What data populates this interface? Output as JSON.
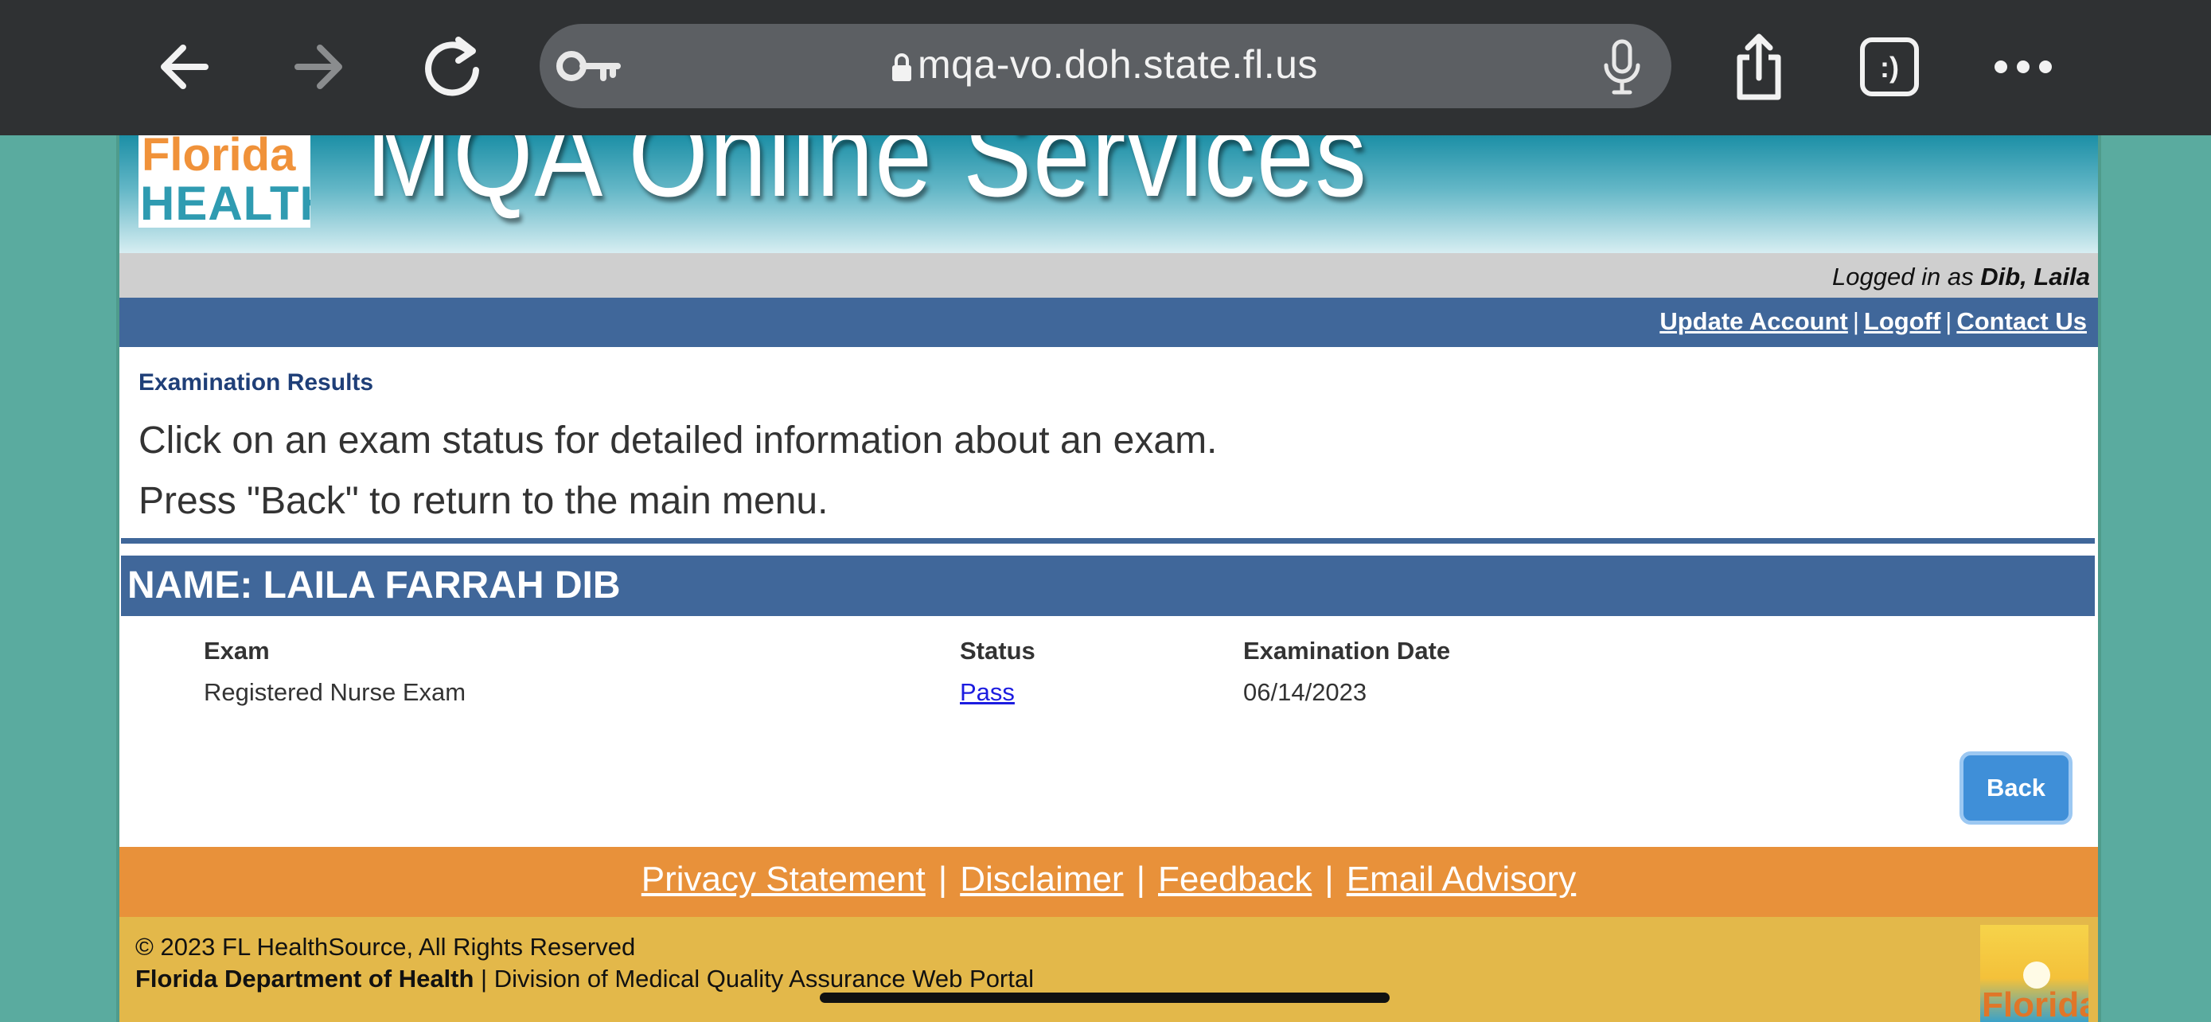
{
  "browser": {
    "url": "mqa-vo.doh.state.fl.us",
    "tab_count_label": ":)",
    "icons": [
      "back-arrow-icon",
      "forward-arrow-icon",
      "reload-icon",
      "key-icon",
      "lock-icon",
      "microphone-icon",
      "share-icon",
      "tabs-icon",
      "more-icon"
    ]
  },
  "header": {
    "logo_line1": "Florida",
    "logo_line2": "HEALTH",
    "title": "MQA Online Services",
    "logged_in_prefix": "Logged in as ",
    "logged_in_user": "Dib, Laila"
  },
  "top_links": [
    {
      "label": "Update Account"
    },
    {
      "label": "Logoff"
    },
    {
      "label": "Contact Us"
    }
  ],
  "top_links_separator": "|",
  "main": {
    "section_title": "Examination Results",
    "instruction_1": "Click on an exam status for detailed information about an exam.",
    "instruction_2": "Press \"Back\" to return to the main menu.",
    "name_label": "NAME: LAILA FARRAH DIB",
    "columns": [
      "Exam",
      "Status",
      "Examination Date"
    ],
    "rows": [
      {
        "exam": "Registered Nurse Exam",
        "status": "Pass",
        "date": "06/14/2023"
      }
    ],
    "back_label": "Back"
  },
  "footer": {
    "links": [
      "Privacy Statement",
      "Disclaimer",
      "Feedback",
      "Email Advisory"
    ],
    "separator": "|",
    "copyright": "© 2023 FL HealthSource, All Rights Reserved",
    "org_bold": "Florida Department of Health",
    "org_rest": " | Division of Medical Quality Assurance Web Portal",
    "logo_text": "Florida"
  },
  "colors": {
    "chrome_bg": "#2f3133",
    "side_bg": "#5aab9f",
    "nav_blue": "#40679a",
    "footer_orange": "#e8913a",
    "footer_gold": "#e3b84a",
    "link_blue": "#1c1ce0",
    "button_blue": "#3f8fd8"
  }
}
